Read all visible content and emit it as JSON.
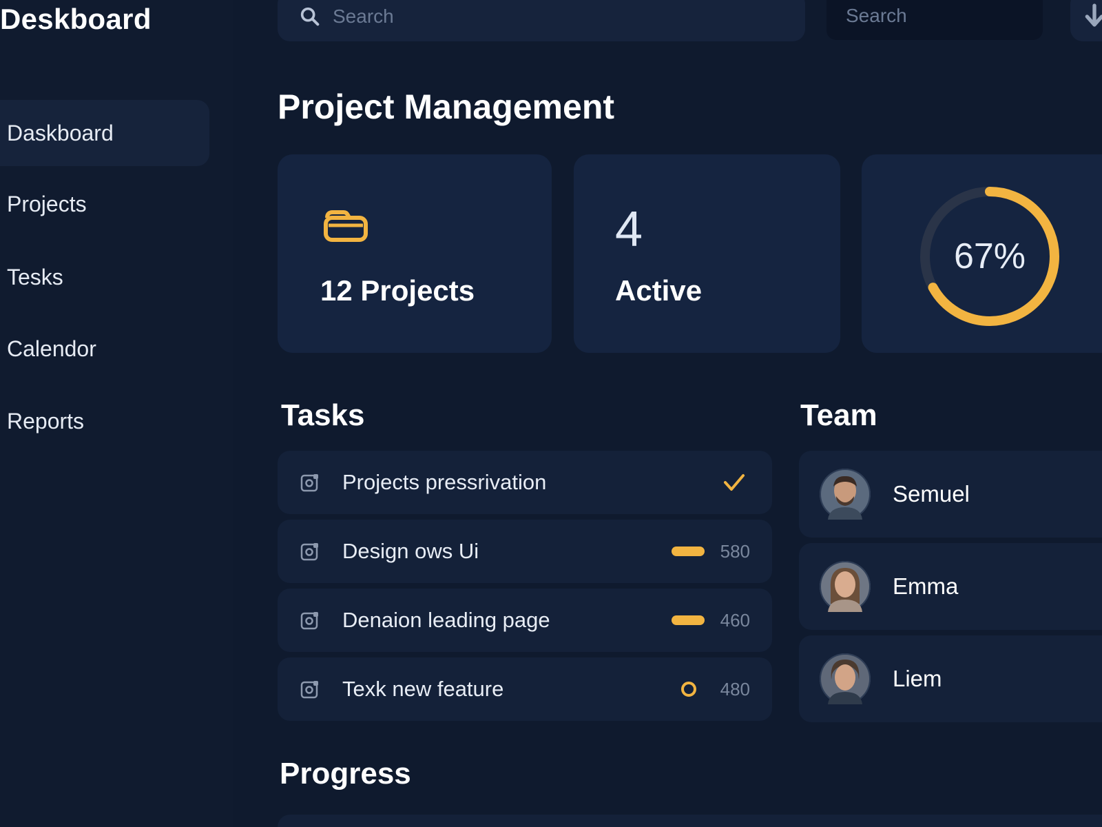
{
  "sidebar": {
    "brand": "Deskboard",
    "items": [
      {
        "label": "Daskboard",
        "active": true
      },
      {
        "label": "Projects",
        "active": false
      },
      {
        "label": "Tesks",
        "active": false
      },
      {
        "label": "Calendor",
        "active": false
      },
      {
        "label": "Reports",
        "active": false
      }
    ]
  },
  "header": {
    "search_placeholder": "Search",
    "secondary_search_placeholder": "Search",
    "download_icon": "download-arrow-icon"
  },
  "page": {
    "title": "Project Management"
  },
  "stats": {
    "projects": {
      "text": "12 Projects",
      "icon": "folder-icon"
    },
    "active": {
      "number": "4",
      "label": "Active"
    },
    "completion": {
      "label": "67%",
      "value": 0.67
    }
  },
  "tasks": {
    "title": "Tasks",
    "items": [
      {
        "label": "Projects pressrivation",
        "status": "done",
        "count": ""
      },
      {
        "label": "Design ows Ui",
        "status": "in-progress",
        "count": "580"
      },
      {
        "label": "Denaion leading page",
        "status": "in-progress",
        "count": "460"
      },
      {
        "label": "Texk new feature",
        "status": "pending",
        "count": "480"
      }
    ]
  },
  "team": {
    "title": "Team",
    "members": [
      {
        "name": "Semuel"
      },
      {
        "name": "Emma"
      },
      {
        "name": "Liem"
      }
    ]
  },
  "progress": {
    "title": "Progress"
  },
  "colors": {
    "background": "#0f1a2e",
    "sidebar": "#101b2f",
    "card": "#152440",
    "accent": "#f2b441",
    "muted_text": "#7a879d"
  }
}
